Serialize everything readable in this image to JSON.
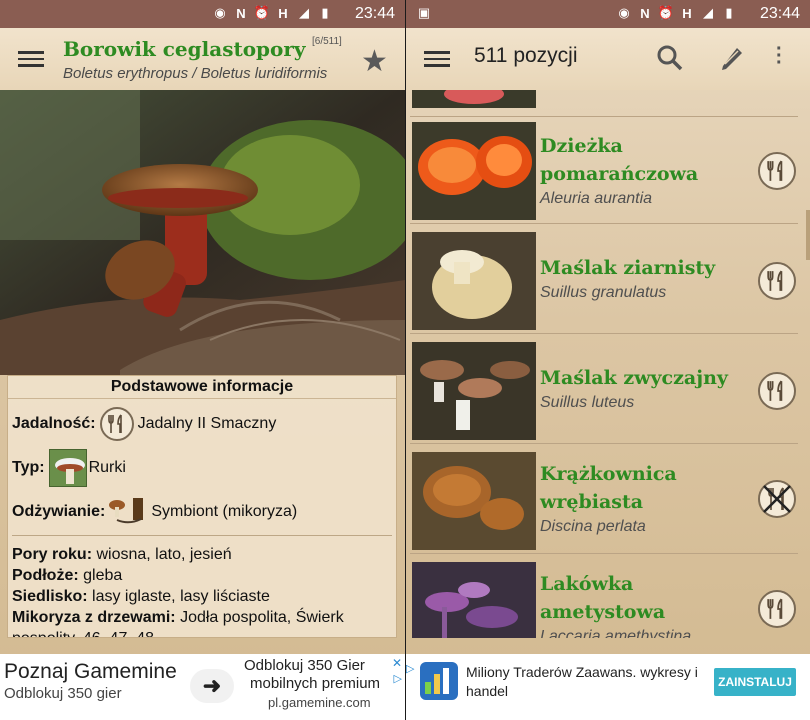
{
  "colors": {
    "status_bar": "#8a5d52",
    "title_green": "#2e8b22",
    "install_button": "#37b2c8"
  },
  "left": {
    "status": {
      "time": "23:44",
      "icons": [
        "nfc-icon",
        "n-icon",
        "alarm-icon",
        "signal-h-icon",
        "cell-signal-icon",
        "battery-icon"
      ]
    },
    "header": {
      "title": "Borowik ceglastopory",
      "latin": "Boletus erythropus / Boletus luridiformis",
      "counter": "[6/511]"
    },
    "info": {
      "heading": "Podstawowe informacje",
      "edibility_label": "Jadalność:",
      "edibility_value": "Jadalny II Smaczny",
      "type_label": "Typ:",
      "type_value": "Rurki",
      "nutrition_label": "Odżywianie:",
      "nutrition_value": "Symbiont (mikoryza)",
      "seasons_label": "Pory roku:",
      "seasons_value": "wiosna, lato, jesień",
      "substrate_label": "Podłoże:",
      "substrate_value": "gleba",
      "habitat_label": "Siedlisko:",
      "habitat_value": "lasy iglaste, lasy liściaste",
      "mycorrhiza_label": "Mikoryza z drzewami:",
      "mycorrhiza_value": "Jodła pospolita, Świerk",
      "mycorrhiza_cont": "pospolity, 46, 47, 48"
    },
    "ad": {
      "headline": "Poznaj Gamemine",
      "subline": "Odblokuj 350 gier",
      "body1": "Odblokuj 350 Gier",
      "body2": "mobilnych premium",
      "domain": "pl.gamemine.com"
    }
  },
  "right": {
    "status": {
      "time": "23:44"
    },
    "header": {
      "title": "511 pozycji"
    },
    "items": [
      {
        "name": "Dzieżka pomarańczowa",
        "latin": "Aleuria aurantia",
        "edible": true
      },
      {
        "name": "Maślak ziarnisty",
        "latin": "Suillus granulatus",
        "edible": true
      },
      {
        "name": "Maślak zwyczajny",
        "latin": "Suillus luteus",
        "edible": true
      },
      {
        "name": "Krążkownica wrębiasta",
        "latin": "Discina perlata",
        "edible": false
      },
      {
        "name": "Lakówka ametystowa",
        "latin": "Laccaria amethystina",
        "edible": true
      }
    ],
    "ad": {
      "text1": "Miliony Traderów Zaawans. wykresy i",
      "text2": "handel",
      "button": "ZAINSTALUJ"
    }
  }
}
